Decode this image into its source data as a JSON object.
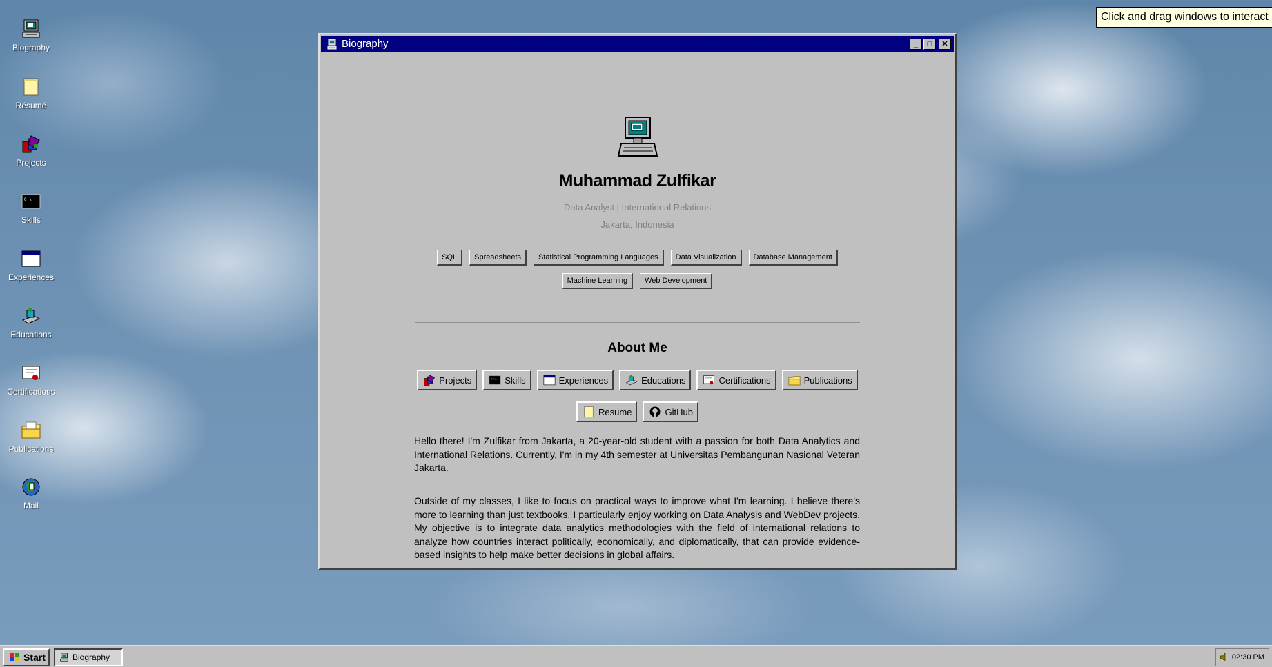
{
  "hint": "Click and drag windows to interact",
  "desktop": {
    "icons": [
      {
        "label": "Biography",
        "icon": "computer-icon"
      },
      {
        "label": "Résumé",
        "icon": "notepad-icon"
      },
      {
        "label": "Projects",
        "icon": "projects-icon"
      },
      {
        "label": "Skills",
        "icon": "terminal-icon"
      },
      {
        "label": "Experiences",
        "icon": "window-icon"
      },
      {
        "label": "Educations",
        "icon": "education-icon"
      },
      {
        "label": "Certifications",
        "icon": "certificate-icon"
      },
      {
        "label": "Publications",
        "icon": "folder-icon"
      },
      {
        "label": "Mail",
        "icon": "mail-icon"
      }
    ]
  },
  "window": {
    "title": "Biography",
    "controls": {
      "minimize": "_",
      "maximize": "□",
      "close": "✕"
    },
    "profile": {
      "name": "Muhammad Zulfikar",
      "tagline": "Data Analyst | International Relations",
      "location": "Jakarta, Indonesia"
    },
    "skills_row1": [
      "SQL",
      "Spreadsheets",
      "Statistical Programming Languages",
      "Data Visualization",
      "Database Management"
    ],
    "skills_row2": [
      "Machine Learning",
      "Web Development"
    ],
    "about_heading": "About Me",
    "nav_row1": [
      {
        "label": "Projects",
        "icon": "projects-icon"
      },
      {
        "label": "Skills",
        "icon": "terminal-icon"
      },
      {
        "label": "Experiences",
        "icon": "window-icon"
      },
      {
        "label": "Educations",
        "icon": "education-icon"
      },
      {
        "label": "Certifications",
        "icon": "certificate-icon"
      },
      {
        "label": "Publications",
        "icon": "folder-icon"
      }
    ],
    "nav_row2": [
      {
        "label": "Resume",
        "icon": "notepad-icon"
      },
      {
        "label": "GitHub",
        "icon": "github-icon"
      }
    ],
    "paragraphs": [
      "Hello there! I'm Zulfikar from Jakarta, a 20-year-old student with a passion for both Data Analytics and International Relations. Currently, I'm in my 4th semester at Universitas Pembangunan Nasional Veteran Jakarta.",
      "Outside of my classes, I like to focus on practical ways to improve what I'm learning. I believe there's more to learning than just textbooks. I particularly enjoy working on Data Analysis and WebDev projects. My objective is to integrate data analytics methodologies with the field of international relations to analyze how countries interact politically, economically, and diplomatically, that can provide evidence-based insights to help make better decisions in global affairs."
    ]
  },
  "taskbar": {
    "start_label": "Start",
    "task_label": "Biography",
    "clock": "02:30 PM"
  },
  "colors": {
    "titlebar": "#000080",
    "window_bg": "#c0c0c0",
    "desktop_sky": "#6e92b4"
  }
}
